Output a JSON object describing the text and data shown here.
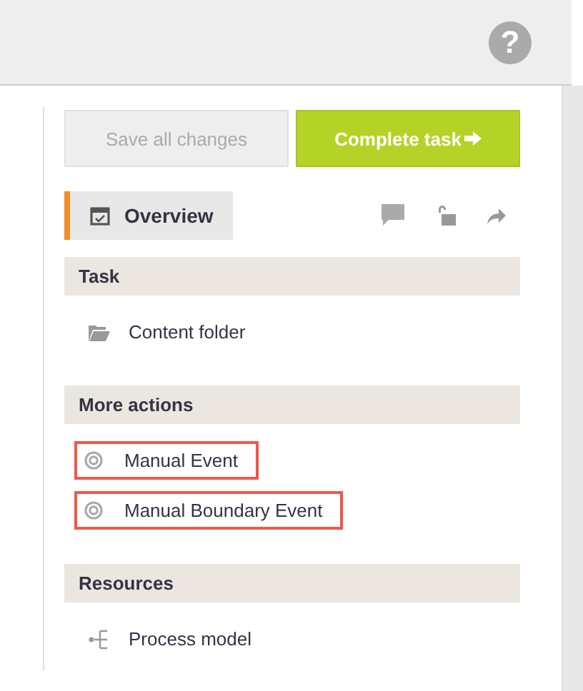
{
  "header": {
    "help_icon": "?"
  },
  "buttons": [
    {
      "kind": "save",
      "label": "Save all changes",
      "disabled": true
    },
    {
      "kind": "complete",
      "label": "Complete task"
    }
  ],
  "tabs": [
    {
      "label": "Overview",
      "selected": true
    }
  ],
  "sections": [
    {
      "title": "Task",
      "items": [
        {
          "kind": "folder",
          "label": "Content folder",
          "highlighted": false
        }
      ]
    },
    {
      "title": "More actions",
      "items": [
        {
          "kind": "event",
          "label": "Manual Event",
          "highlighted": true
        },
        {
          "kind": "event",
          "label": "Manual Boundary Event",
          "highlighted": true
        }
      ]
    },
    {
      "title": "Resources",
      "items": [
        {
          "kind": "process",
          "label": "Process model",
          "highlighted": false
        }
      ]
    }
  ]
}
